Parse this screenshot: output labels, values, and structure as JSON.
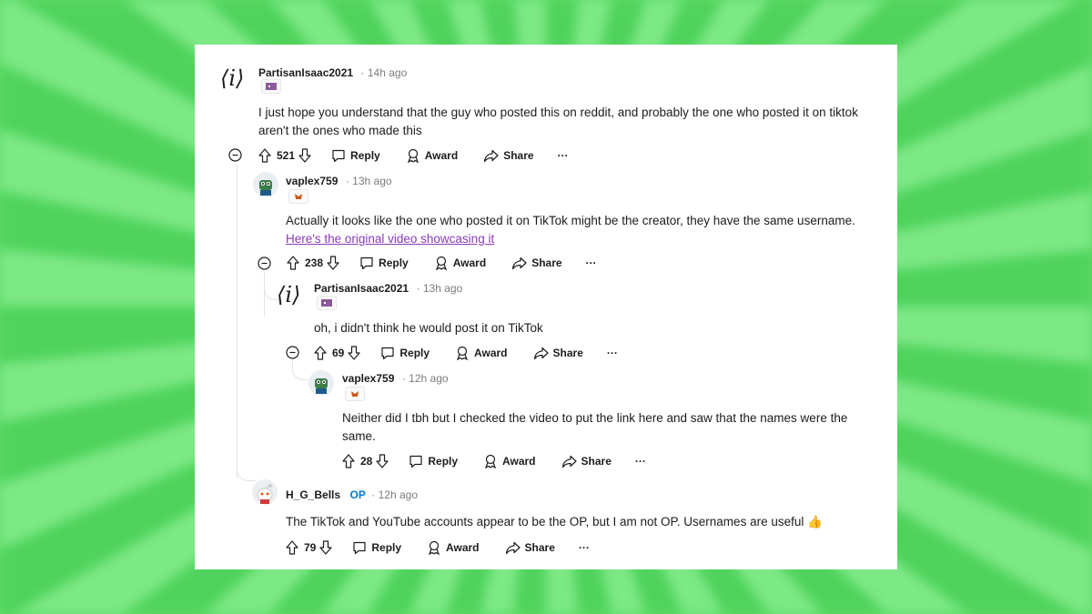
{
  "colors": {
    "accent_op": "#0079d3",
    "link": "#8a3ab9",
    "text": "#1c1c1c",
    "meta": "#7c7c7c",
    "background": "#5fdc6a"
  },
  "comments": [
    {
      "username": "PartisanIsaac2021",
      "time": "· 14h ago",
      "text": "I just hope you understand that the guy who posted this on reddit, and probably the one who posted it on tiktok aren't the ones who made this",
      "score": "521",
      "reply": "Reply",
      "award": "Award",
      "share": "Share",
      "more": "···"
    },
    {
      "username": "vaplex759",
      "time": "· 13h ago",
      "text_before_link": "Actually it looks like the one who posted it on TikTok might be the creator, they have the same username.",
      "link_text": "Here's the original video showcasing it",
      "score": "238",
      "reply": "Reply",
      "award": "Award",
      "share": "Share",
      "more": "···"
    },
    {
      "username": "PartisanIsaac2021",
      "time": "· 13h ago",
      "text": "oh, i didn't think he would post it on TikTok",
      "score": "69",
      "reply": "Reply",
      "award": "Award",
      "share": "Share",
      "more": "···"
    },
    {
      "username": "vaplex759",
      "time": "· 12h ago",
      "text": "Neither did I tbh but I checked the video to put the link here and saw that the names were the same.",
      "score": "28",
      "reply": "Reply",
      "award": "Award",
      "share": "Share",
      "more": "···"
    },
    {
      "username": "H_G_Bells",
      "op_badge": "OP",
      "time": "· 12h ago",
      "text": "The TikTok and YouTube accounts appear to be the OP, but I am not OP. Usernames are useful",
      "emoji": "👍",
      "score": "79",
      "reply": "Reply",
      "award": "Award",
      "share": "Share",
      "more": "···"
    }
  ],
  "icons": {
    "upvote": "upvote-icon",
    "downvote": "downvote-icon",
    "reply": "comment-bubble-icon",
    "award": "award-ribbon-icon",
    "share": "share-arrow-icon",
    "collapse": "collapse-minus-icon"
  },
  "avatar_glyph": "⟨i⟩"
}
